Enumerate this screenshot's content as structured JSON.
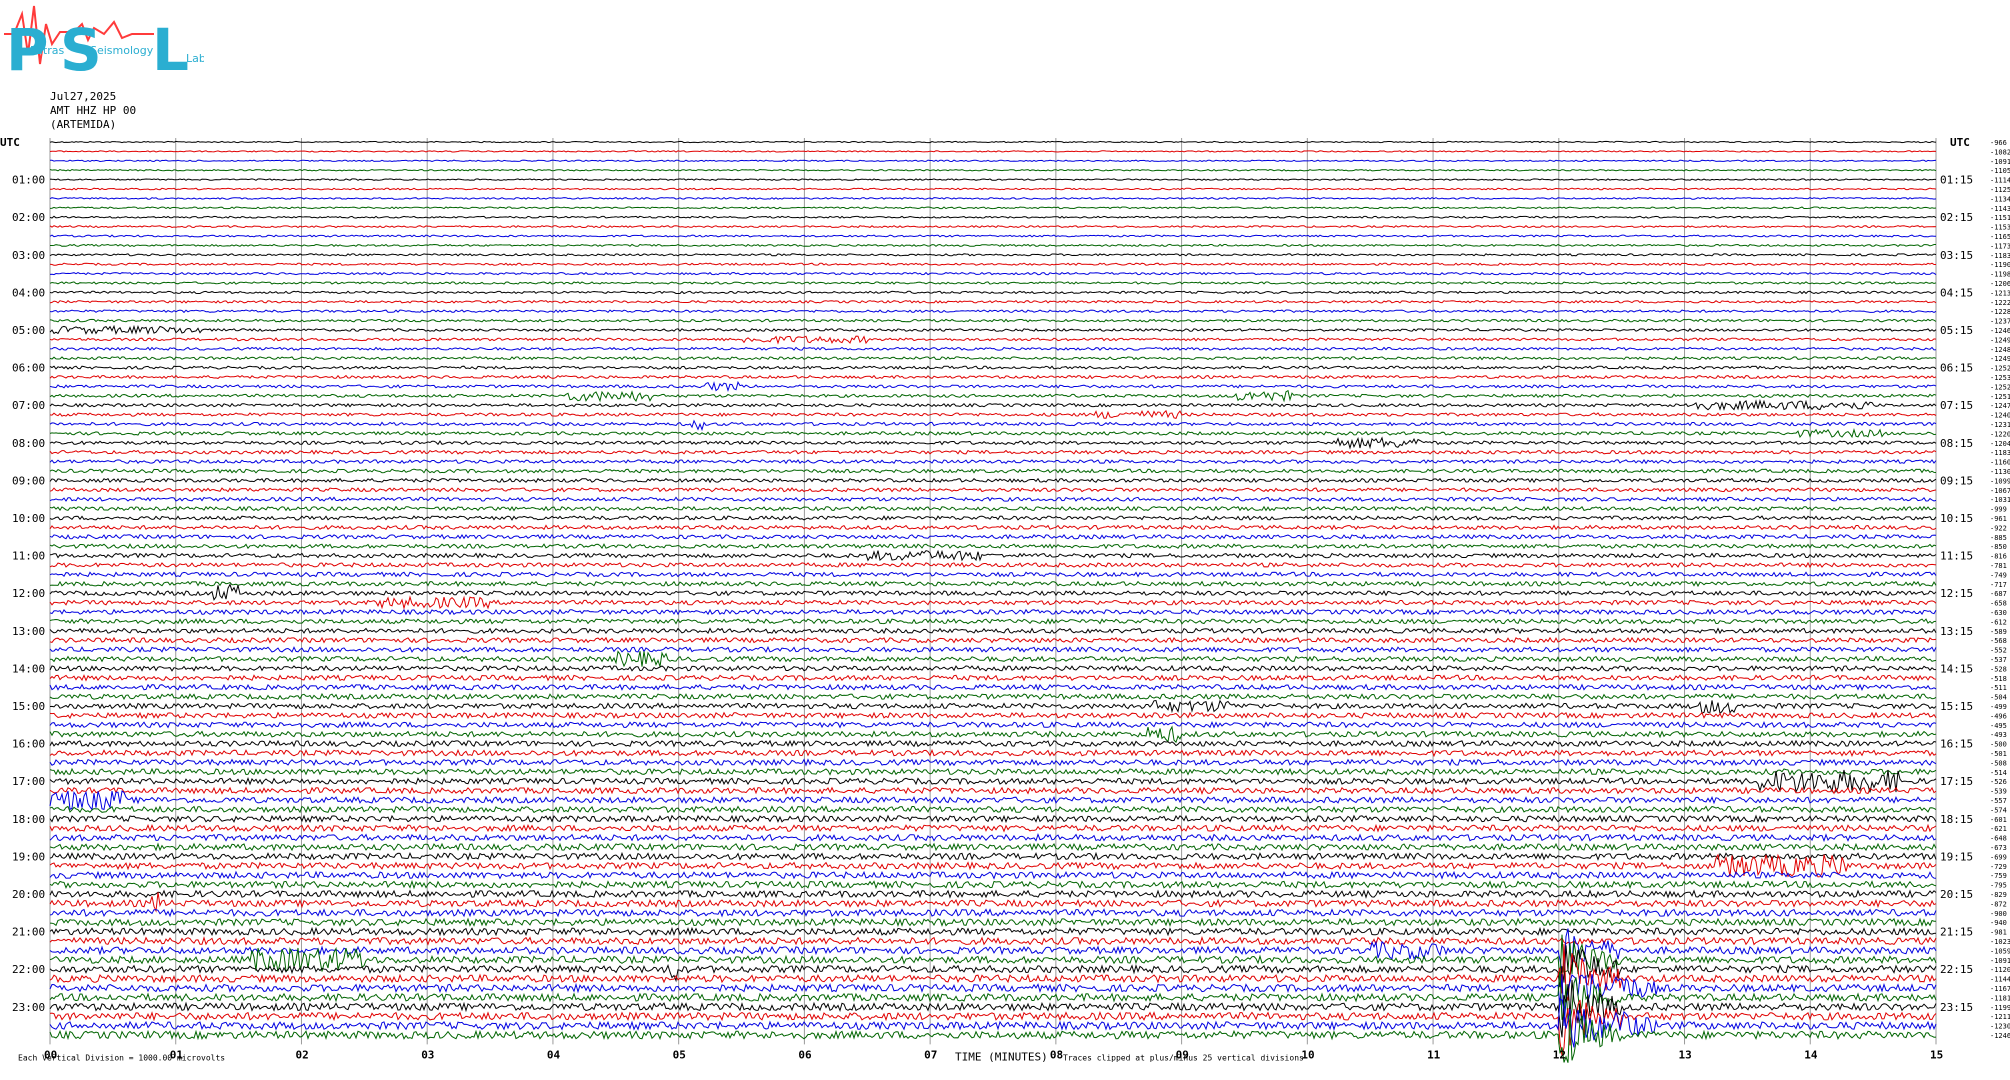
{
  "logo": {
    "letters": [
      "P",
      "S",
      "L"
    ],
    "subtitle_words": [
      "Patras",
      "Seismology",
      "Lab"
    ],
    "color": "#2aaed1",
    "wave_color": "#ff3b3b"
  },
  "header": {
    "date": "Jul27,2025",
    "station": "AMT HHZ HP 00",
    "location": "(ARTEMIDA)"
  },
  "chart_data": {
    "type": "helicorder",
    "trace_colors": [
      "#000000",
      "#e00000",
      "#0000e0",
      "#006400"
    ],
    "utc_label": "UTC",
    "left_hour_labels": [
      "01:00",
      "02:00",
      "03:00",
      "04:00",
      "05:00",
      "06:00",
      "07:00",
      "08:00",
      "09:00",
      "10:00",
      "11:00",
      "12:00",
      "13:00",
      "14:00",
      "15:00",
      "16:00",
      "17:00",
      "18:00",
      "19:00",
      "20:00",
      "21:00",
      "22:00",
      "23:00"
    ],
    "right_hour_labels": [
      "01:15",
      "02:15",
      "03:15",
      "04:15",
      "05:15",
      "06:15",
      "07:15",
      "08:15",
      "09:15",
      "10:15",
      "11:15",
      "12:15",
      "13:15",
      "14:15",
      "15:15",
      "16:15",
      "17:15",
      "18:15",
      "19:15",
      "20:15",
      "21:15",
      "22:15",
      "23:15"
    ],
    "x_ticks": [
      "00",
      "01",
      "02",
      "03",
      "04",
      "05",
      "06",
      "07",
      "08",
      "09",
      "10",
      "11",
      "12",
      "13",
      "14",
      "15"
    ],
    "xlabel": "TIME (MINUTES)",
    "footer_left": "Each Vertical Division = 1000.00 microvolts",
    "footer_right": "Traces clipped at plus/minus 25 vertical divisions",
    "offsets": [
      -966,
      -1082,
      -1091,
      -1105,
      -1114,
      -1125,
      -1134,
      -1143,
      -1151,
      -1153,
      -1165,
      -1173,
      -1183,
      -1190,
      -1198,
      -1206,
      -1213,
      -1222,
      -1228,
      -1237,
      -1246,
      -1249,
      -1248,
      -1249,
      -1252,
      -1253,
      -1252,
      -1251,
      -1247,
      -1240,
      -1231,
      -1220,
      -1204,
      -1183,
      -1160,
      -1130,
      -1099,
      -1067,
      -1031,
      -999,
      -961,
      -922,
      -885,
      -850,
      -816,
      -781,
      -749,
      -717,
      -687,
      -658,
      -630,
      -612,
      -589,
      -568,
      -552,
      -537,
      -528,
      -518,
      -511,
      -504,
      -499,
      -496,
      -495,
      -493,
      -500,
      -501,
      -508,
      -514,
      -526,
      -539,
      -557,
      -574,
      -601,
      -621,
      -648,
      -673,
      -699,
      -729,
      -759,
      -795,
      -829,
      -872,
      -900,
      -940,
      -981,
      -1023,
      -1059,
      -1091,
      -1120,
      -1144,
      -1167,
      -1181,
      -1199,
      -1211,
      -1230,
      -1246
    ]
  }
}
